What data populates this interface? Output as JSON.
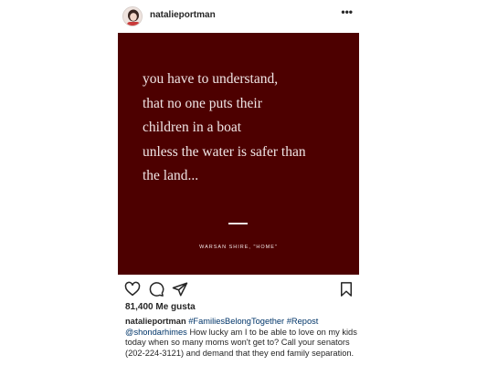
{
  "post": {
    "username": "natalieportman",
    "more_icon": "more-options-icon",
    "image": {
      "background": "#4d0000",
      "quote": "you have to understand,\nthat no one puts their\nchildren in a boat\nunless the water is safer than\nthe land...",
      "credit": "WARSAN SHIRE, \"HOME\""
    },
    "actions": {
      "like_icon": "heart-icon",
      "comment_icon": "comment-icon",
      "share_icon": "send-icon",
      "save_icon": "bookmark-icon"
    },
    "likes_text": "81,400 Me gusta",
    "caption": {
      "user": "natalieportman",
      "hashtag1": "#FamiliesBelongTogether",
      "hashtag2": "#Repost",
      "mention": "@shondarhimes",
      "text": "How lucky am I to be able to love on my kids today when so many moms won't get to? Call your senators (202-224-3121) and demand that they end family separation."
    }
  }
}
